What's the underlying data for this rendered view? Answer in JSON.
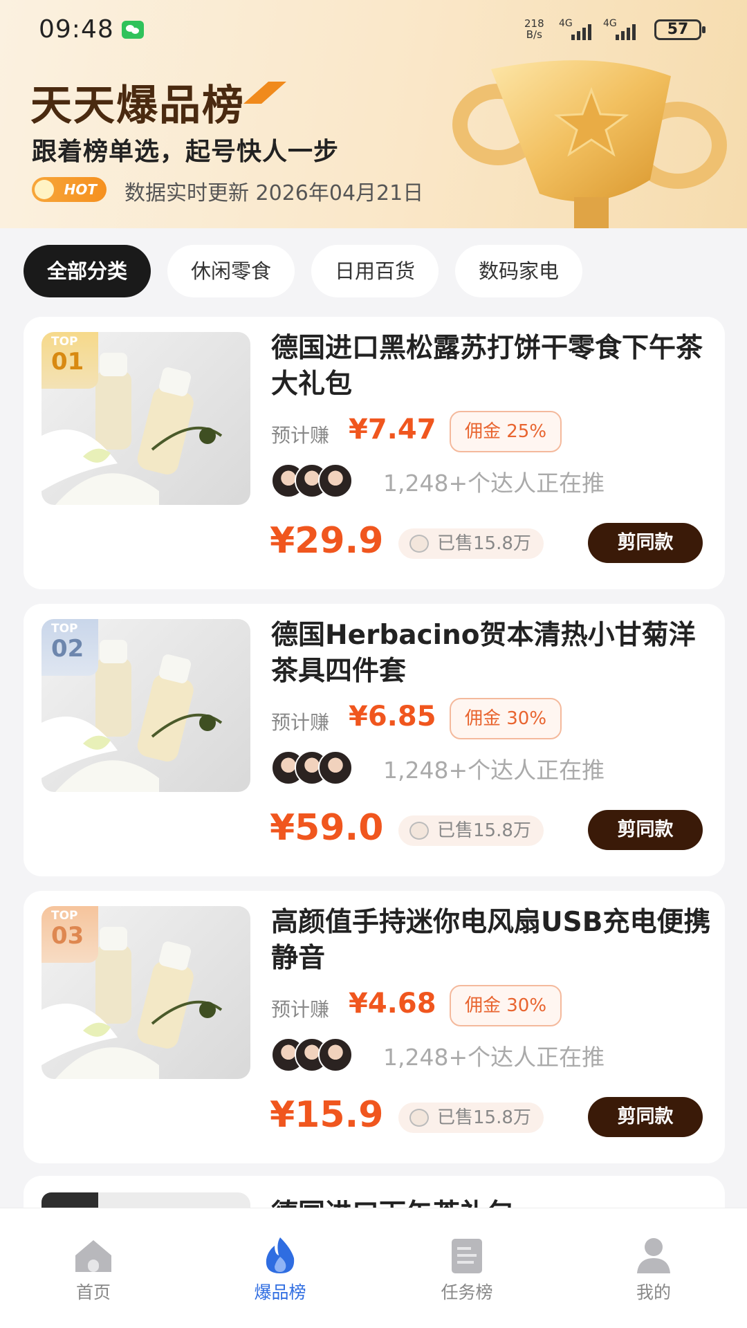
{
  "status_bar": {
    "time": "09:48",
    "net_speed_value": "218",
    "net_speed_unit": "B/s",
    "signal_1": "4G",
    "signal_2": "4G",
    "battery": "57"
  },
  "header": {
    "brand_title": "天天爆品榜",
    "slogan": "跟着榜单选，起号快人一步",
    "hot_badge": "HOT",
    "update_text": "数据实时更新 2026年04月21日"
  },
  "tabs": [
    {
      "label": "全部分类",
      "active": true
    },
    {
      "label": "休闲零食",
      "active": false
    },
    {
      "label": "日用百货",
      "active": false
    },
    {
      "label": "数码家电",
      "active": false
    }
  ],
  "products": [
    {
      "rank_label": "TOP",
      "rank": "01",
      "title": "德国进口黑松露苏打饼干零食下午茶大礼包",
      "earn_label": "预计赚",
      "earn": "¥7.47",
      "commission": "佣金 25%",
      "push_text": "1,248+个达人正在推",
      "price": "¥29.9",
      "sold": "已售15.8万",
      "button": "剪同款"
    },
    {
      "rank_label": "TOP",
      "rank": "02",
      "title": "德国Herbacino贺本清热小甘菊洋茶具四件套",
      "earn_label": "预计赚",
      "earn": "¥6.85",
      "commission": "佣金 30%",
      "push_text": "1,248+个达人正在推",
      "price": "¥59.0",
      "sold": "已售15.8万",
      "button": "剪同款"
    },
    {
      "rank_label": "TOP",
      "rank": "03",
      "title": "高颜值手持迷你电风扇USB充电便携静音",
      "earn_label": "预计赚",
      "earn": "¥4.68",
      "commission": "佣金 30%",
      "push_text": "1,248+个达人正在推",
      "price": "¥15.9",
      "sold": "已售15.8万",
      "button": "剪同款"
    }
  ],
  "partial_product": {
    "title": "德国进口下午茶礼包"
  },
  "bottom_nav": [
    {
      "label": "首页",
      "icon": "home-icon",
      "active": false
    },
    {
      "label": "爆品榜",
      "icon": "flame-icon",
      "active": true
    },
    {
      "label": "任务榜",
      "icon": "task-icon",
      "active": false
    },
    {
      "label": "我的",
      "icon": "user-icon",
      "active": false
    }
  ],
  "colors": {
    "accent_price": "#f0561e",
    "nav_active": "#2f6de1",
    "button_bg": "#3a1a08"
  }
}
